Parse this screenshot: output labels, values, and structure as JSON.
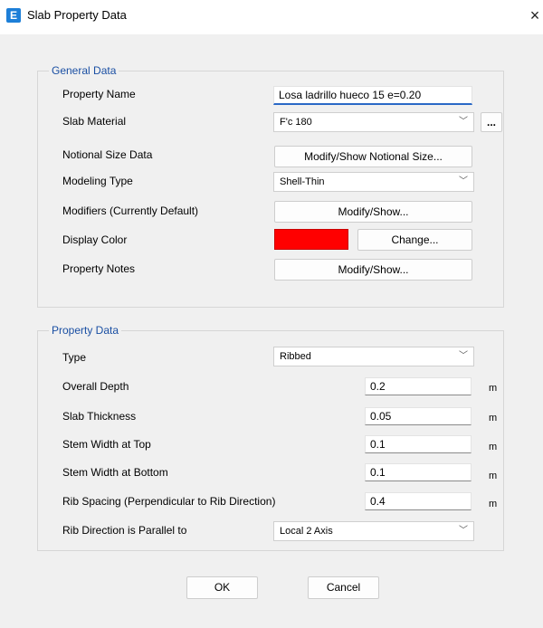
{
  "window": {
    "title": "Slab Property Data",
    "app_icon_letter": "E",
    "close_glyph": "×"
  },
  "general": {
    "legend": "General Data",
    "property_name_label": "Property Name",
    "property_name_value": "Losa ladrillo hueco 15 e=0.20",
    "slab_material_label": "Slab Material",
    "slab_material_value": "F'c 180",
    "slab_material_more": "...",
    "notional_label": "Notional Size Data",
    "notional_button": "Modify/Show Notional Size...",
    "modeling_type_label": "Modeling Type",
    "modeling_type_value": "Shell-Thin",
    "modifiers_label": "Modifiers (Currently Default)",
    "modifiers_button": "Modify/Show...",
    "display_color_label": "Display Color",
    "display_color_value": "#ff0000",
    "change_button": "Change...",
    "property_notes_label": "Property Notes",
    "notes_button": "Modify/Show..."
  },
  "property": {
    "legend": "Property Data",
    "type_label": "Type",
    "type_value": "Ribbed",
    "overall_depth_label": "Overall Depth",
    "overall_depth_value": "0.2",
    "slab_thickness_label": "Slab Thickness",
    "slab_thickness_value": "0.05",
    "stem_top_label": "Stem Width at Top",
    "stem_top_value": "0.1",
    "stem_bottom_label": "Stem Width at Bottom",
    "stem_bottom_value": "0.1",
    "rib_spacing_label": "Rib Spacing (Perpendicular to Rib Direction)",
    "rib_spacing_value": "0.4",
    "rib_direction_label": "Rib Direction is Parallel to",
    "rib_direction_value": "Local 2 Axis",
    "unit": "m"
  },
  "footer": {
    "ok": "OK",
    "cancel": "Cancel"
  },
  "icons": {
    "chevron": "﹀"
  }
}
